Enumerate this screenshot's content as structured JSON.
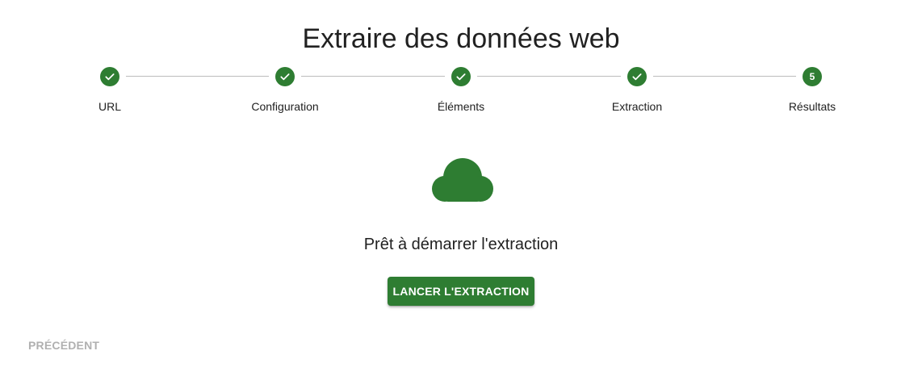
{
  "page": {
    "title": "Extraire des données web"
  },
  "stepper": {
    "steps": [
      {
        "label": "URL",
        "state": "completed",
        "icon": "check-icon"
      },
      {
        "label": "Configuration",
        "state": "completed",
        "icon": "check-icon"
      },
      {
        "label": "Éléments",
        "state": "completed",
        "icon": "check-icon"
      },
      {
        "label": "Extraction",
        "state": "completed",
        "icon": "check-icon"
      },
      {
        "label": "Résultats",
        "state": "active",
        "number": "5"
      }
    ],
    "accent_color": "#2e7d32"
  },
  "main": {
    "icon": "cloud-icon",
    "status_text": "Prêt à démarrer l'extraction",
    "launch_label": "LANCER L'EXTRACTION"
  },
  "footer": {
    "previous_label": "PRÉCÉDENT",
    "previous_disabled": true
  }
}
